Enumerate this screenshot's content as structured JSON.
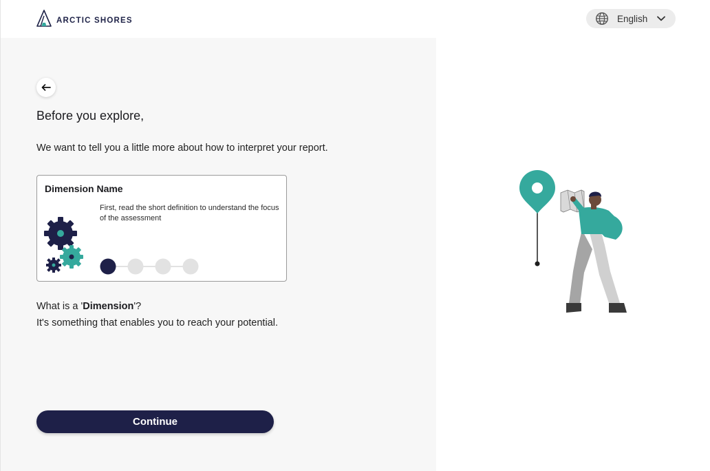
{
  "header": {
    "logo_text": "ARCTIC SHORES",
    "language": "English"
  },
  "content": {
    "heading": "Before you explore,",
    "intro": "We want to tell you a little more about how to interpret your report.",
    "card": {
      "title": "Dimension Name",
      "description": "First, read the short definition to understand the focus of the assessment",
      "steps_total": 4,
      "steps_active": 1
    },
    "question_prefix": "What is a '",
    "question_term": "Dimension",
    "question_suffix": "'?",
    "answer": "It's something that enables you to reach your potential.",
    "continue_label": "Continue"
  },
  "colors": {
    "navy": "#1e2048",
    "teal": "#35a99d",
    "panel_bg": "#f7f7f7",
    "step_inactive": "#e2e2e2"
  },
  "icons": [
    "arctic-shores-logo-icon",
    "globe-icon",
    "chevron-down-icon",
    "arrow-left-icon",
    "gears-icon"
  ]
}
